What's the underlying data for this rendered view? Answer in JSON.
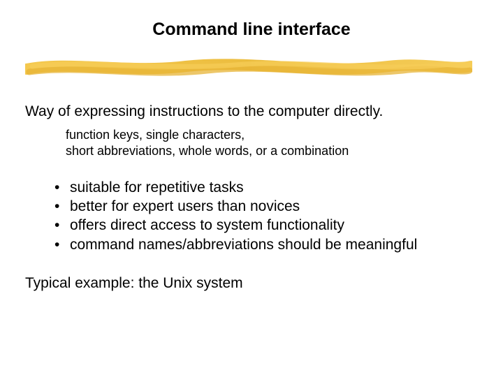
{
  "title": "Command line interface",
  "intro": "Way of expressing instructions to the computer directly.",
  "subnote_line1": "function keys, single characters,",
  "subnote_line2": "short abbreviations, whole words, or a combination",
  "bullets": {
    "b0": "suitable for repetitive tasks",
    "b1": "better for expert users than novices",
    "b2": "offers direct access to system functionality",
    "b3": "command names/abbreviations should be meaningful"
  },
  "example": "Typical example: the Unix system"
}
